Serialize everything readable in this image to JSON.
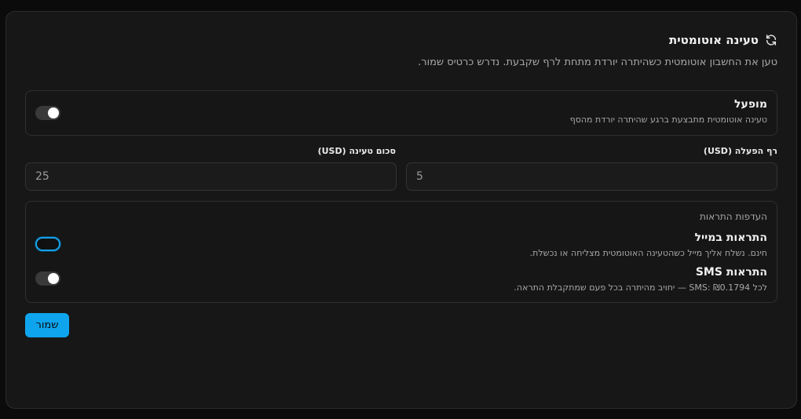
{
  "header": {
    "title": "טעינה אוטומטית",
    "subtitle": "טען את החשבון אוטומטית כשהיתרה יורדת מתחת לרף שקבעת. נדרש כרטיס שמור."
  },
  "enabled": {
    "title": "מופעל",
    "description": "טעינה אוטומטית מתבצעת ברגע שהיתרה יורדת מהסף",
    "state": "off"
  },
  "fields": {
    "threshold": {
      "label": "רף הפעלה (USD)",
      "value": "5"
    },
    "amount": {
      "label": "סכום טעינה (USD)",
      "value": "25"
    }
  },
  "notifications": {
    "section_title": "העדפות התראות",
    "email": {
      "title": "התראות במייל",
      "description": "חינם. נשלח אליך מייל כשהטעינה האוטומטית מצליחה או נכשלת.",
      "state": "on"
    },
    "sms": {
      "title": "התראות SMS",
      "description": "לכל SMS: ₪0.1794 — יחויב מהיתרה בכל פעם שמתקבלת התראה.",
      "state": "off"
    }
  },
  "actions": {
    "save_label": "שמור"
  },
  "colors": {
    "accent": "#0ea5ee",
    "background": "#171717"
  },
  "icons": {
    "header": "refresh-icon"
  }
}
